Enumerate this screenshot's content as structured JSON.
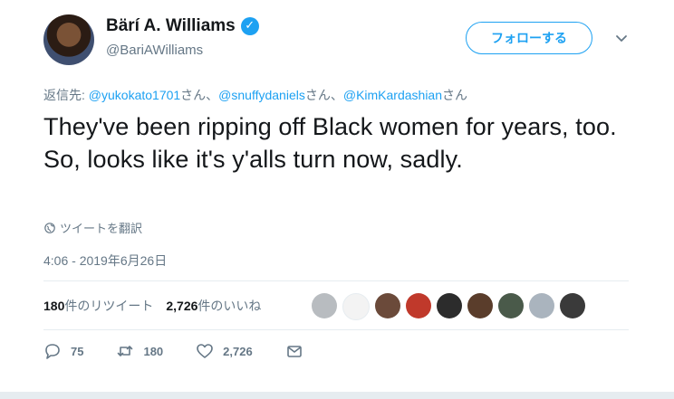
{
  "author": {
    "display_name": "Bärí A. Williams",
    "handle": "@BariAWilliams",
    "verified_icon": "verified-badge-icon"
  },
  "follow_button_label": "フォローする",
  "reply_to": {
    "prefix": "返信先: ",
    "mentions": [
      {
        "handle": "@yukokato1701",
        "suffix": "さん、"
      },
      {
        "handle": "@snuffydaniels",
        "suffix": "さん、"
      },
      {
        "handle": "@KimKardashian",
        "suffix": "さん"
      }
    ]
  },
  "tweet_text": "They've been ripping off Black women for years, too. So, looks like it's y'alls turn now, sadly.",
  "translate_label": "ツイートを翻訳",
  "timestamp": "4:06 - 2019年6月26日",
  "stats": {
    "retweets_count": "180",
    "retweets_label": "件のリツイート",
    "likes_count": "2,726",
    "likes_label": "件のいいね"
  },
  "liker_avatars": [
    "#b8bcc0",
    "#f3f3f3",
    "#6b4a3a",
    "#c0392b",
    "#2c2c2c",
    "#5a3d2b",
    "#4a5a4a",
    "#aab4be",
    "#3a3a3a"
  ],
  "actions": {
    "reply_count": "75",
    "retweet_count": "180",
    "like_count": "2,726"
  },
  "colors": {
    "accent": "#1da1f2",
    "text": "#14171a",
    "secondary": "#657786"
  }
}
